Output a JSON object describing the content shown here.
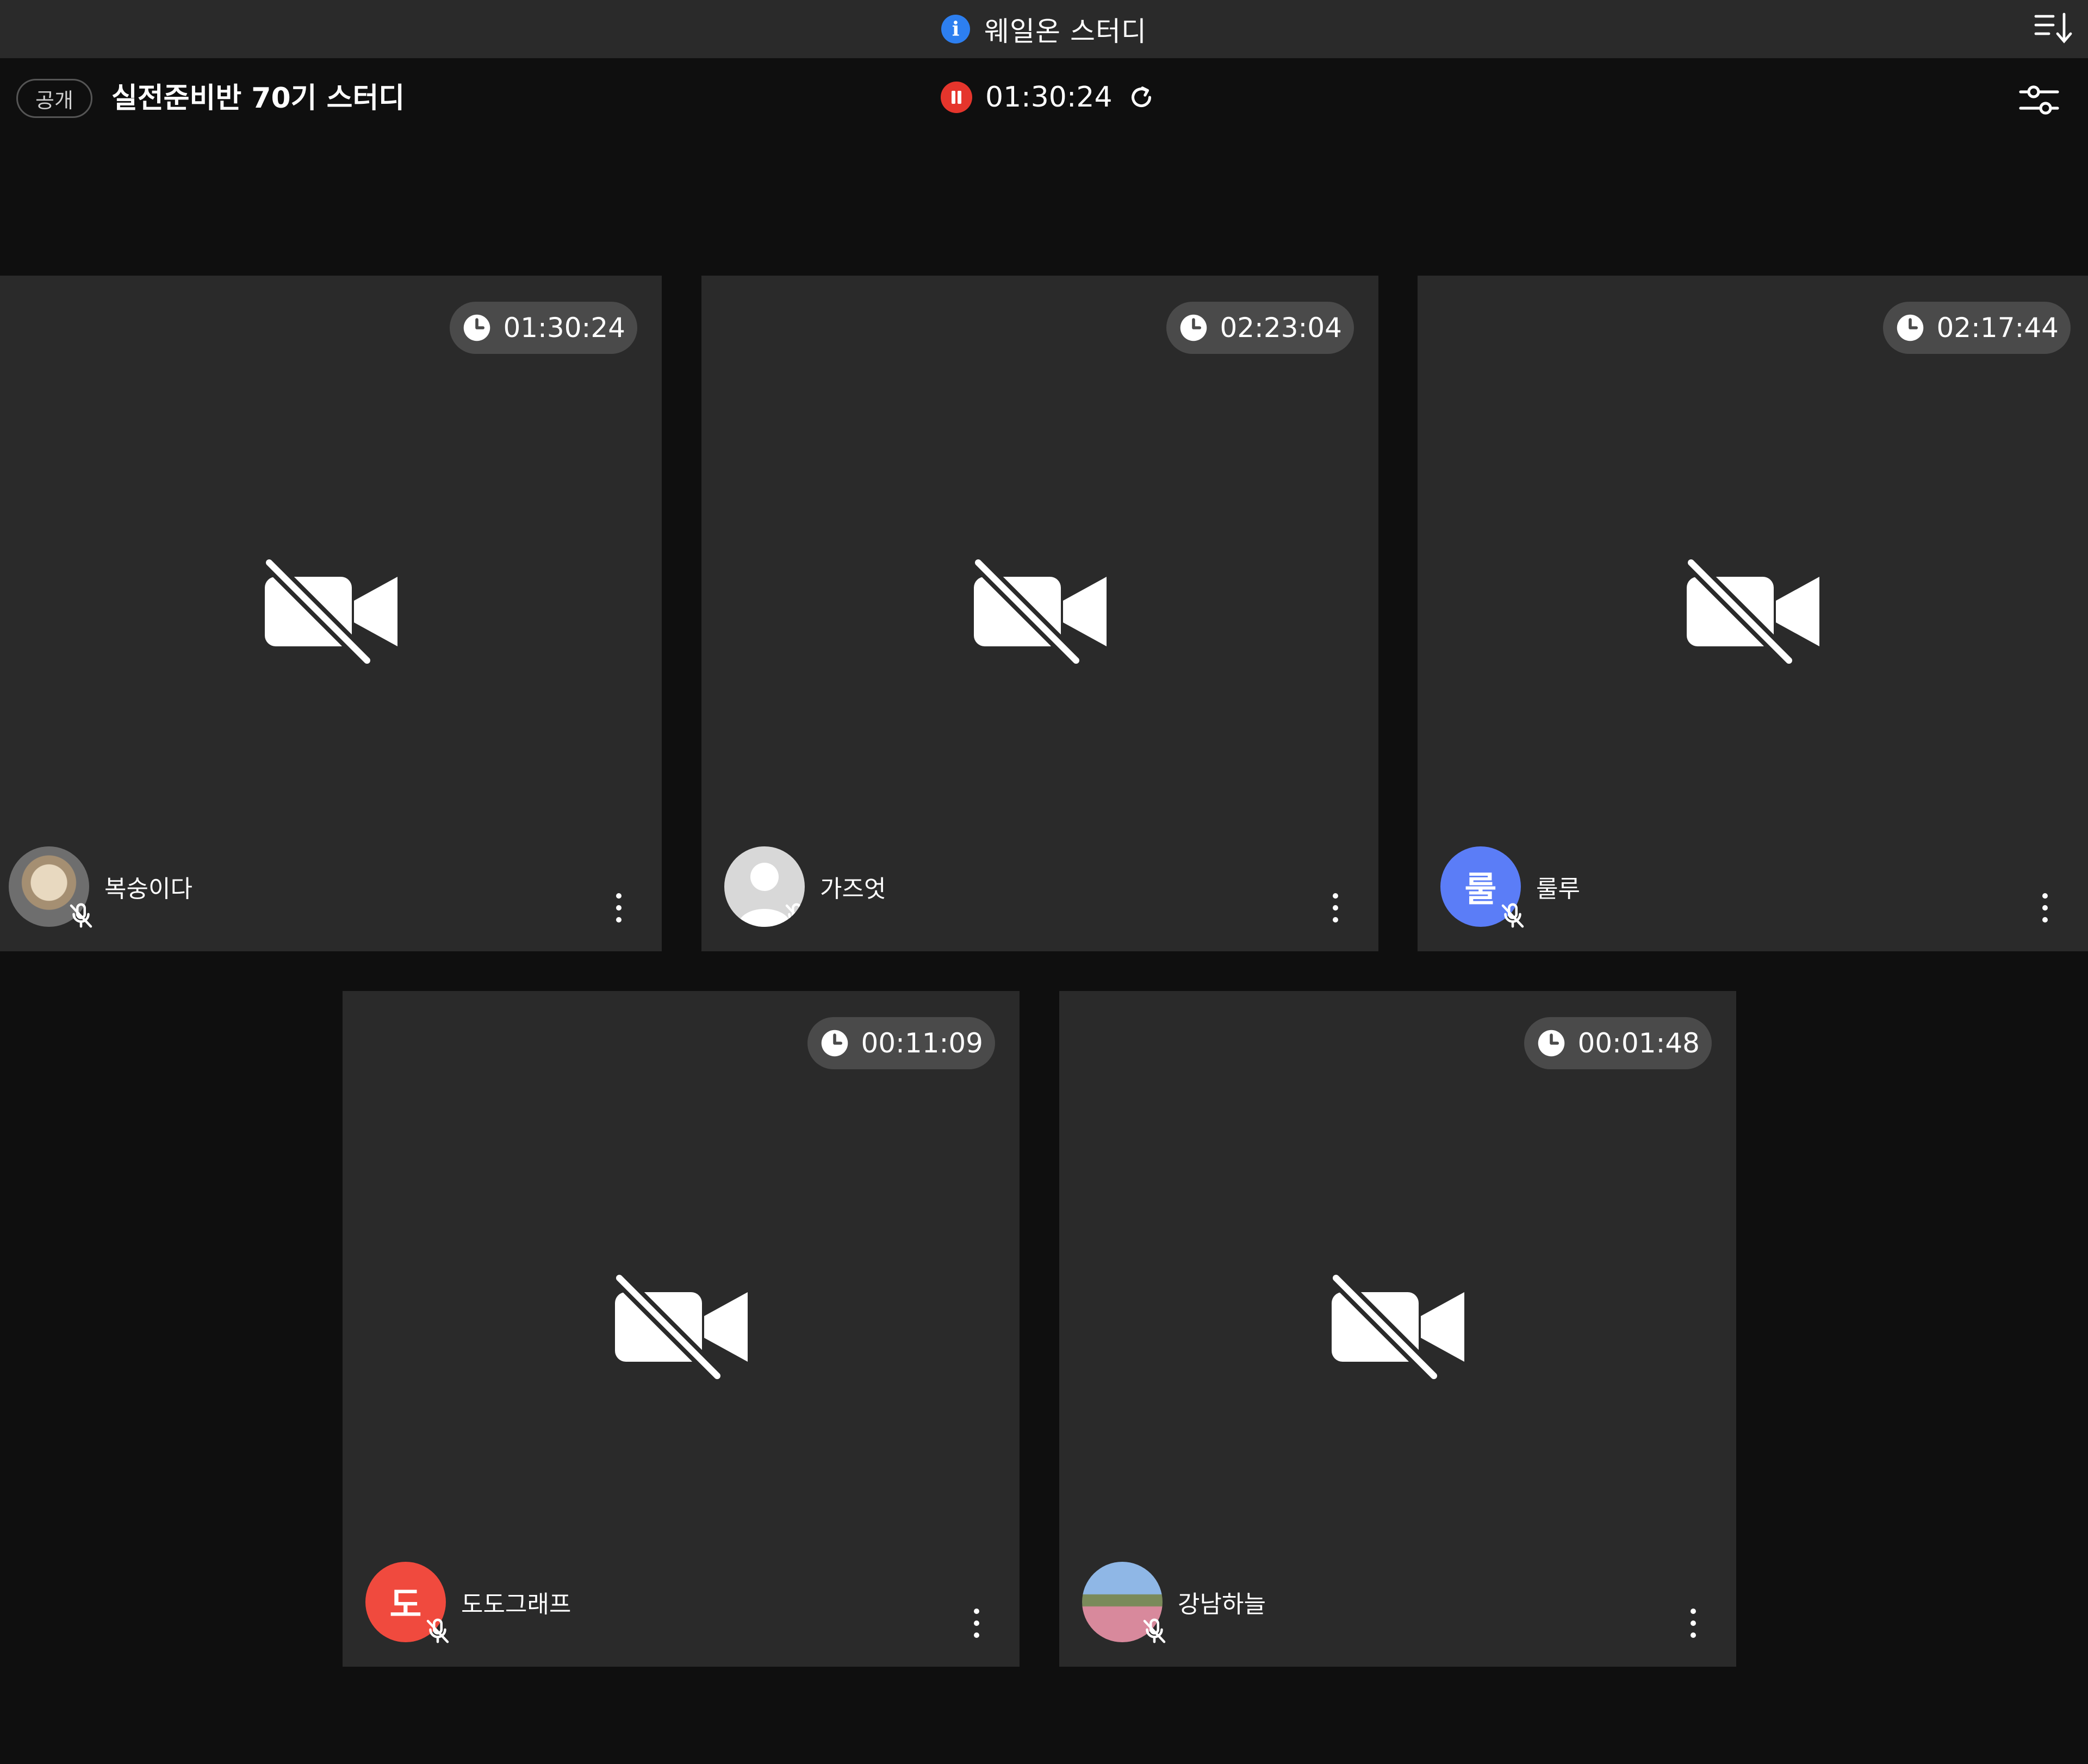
{
  "topbar": {
    "title": "웨일온 스터디",
    "info_icon": "info-icon",
    "sort_icon": "sort-icon"
  },
  "header": {
    "visibility_badge": "공개",
    "room_title": "실전준비반 70기 스터디",
    "session_timer": "01:30:24",
    "record_icon": "pause-record-icon",
    "refresh_icon": "refresh-icon",
    "settings_icon": "settings-sliders-icon"
  },
  "colors": {
    "background": "#0f0f0f",
    "tile": "#2a2a2a",
    "topbar": "#2a2a2a",
    "pill": "#4a4a4a",
    "accent_blue": "#2d7ff0",
    "record_red": "#e5352c",
    "avatar_blue": "#5b7df7",
    "avatar_red": "#f04a3e"
  },
  "participants": [
    {
      "name": "복숭이다",
      "timer": "01:30:24",
      "avatar_letter": "",
      "avatar_type": "photo"
    },
    {
      "name": "가즈엇",
      "timer": "02:23:04",
      "avatar_letter": "",
      "avatar_type": "default"
    },
    {
      "name": "룰루",
      "timer": "02:17:44",
      "avatar_letter": "룰",
      "avatar_type": "letter"
    },
    {
      "name": "도도그래프",
      "timer": "00:11:09",
      "avatar_letter": "도",
      "avatar_type": "letter"
    },
    {
      "name": "강남하늘",
      "timer": "00:01:48",
      "avatar_letter": "",
      "avatar_type": "photo"
    }
  ]
}
